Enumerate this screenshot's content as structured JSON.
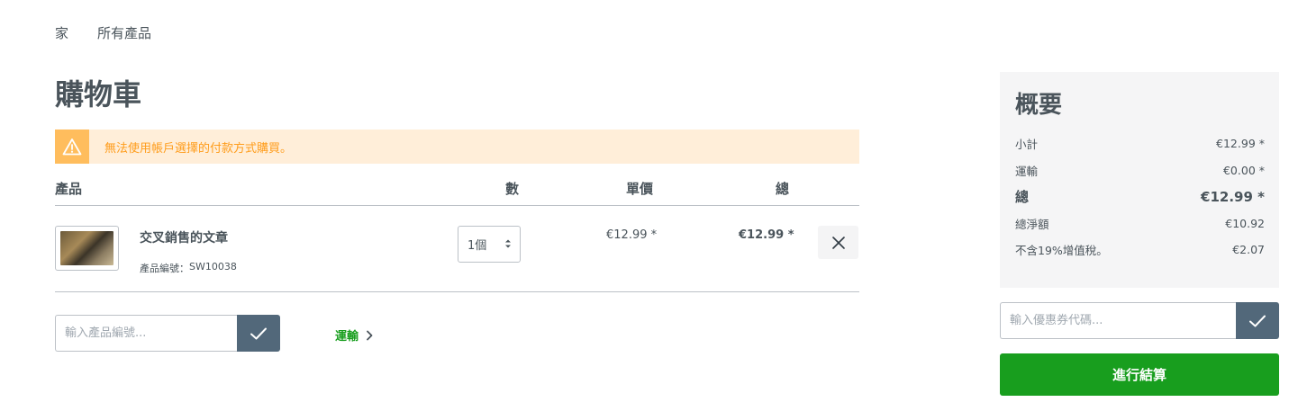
{
  "breadcrumb": {
    "home": "家",
    "all_products": "所有產品"
  },
  "page": {
    "title": "購物車"
  },
  "alert": {
    "message": "無法使用帳戶選擇的付款方式購買。",
    "icon": "warning-icon"
  },
  "cart_table": {
    "headers": {
      "product": "產品",
      "quantity": "數",
      "unit_price": "單價",
      "total": "總"
    },
    "items": [
      {
        "name": "交叉銷售的文章",
        "number_label": "產品編號：",
        "number": "SW10038",
        "quantity": "1個",
        "unit_price": "€12.99 *",
        "total": "€12.99 *"
      }
    ]
  },
  "add_product": {
    "placeholder": "輸入產品編號..."
  },
  "shipping_link": {
    "label": "運輸"
  },
  "summary": {
    "title": "概要",
    "rows": [
      {
        "label": "小計",
        "value": "€12.99 *"
      },
      {
        "label": "運輸",
        "value": "€0.00 *"
      },
      {
        "label": "總",
        "value": "€12.99 *"
      },
      {
        "label": "總淨額",
        "value": "€10.92"
      },
      {
        "label": "不含19%增值稅。",
        "value": "€2.07"
      }
    ]
  },
  "voucher": {
    "placeholder": "輸入優惠券代碼..."
  },
  "checkout": {
    "label": "進行結算"
  },
  "colors": {
    "primary_green": "#189e1e",
    "button_slate": "#52687a",
    "warning_bg": "#ffeed9",
    "warning_accent": "#ffbd5d"
  }
}
